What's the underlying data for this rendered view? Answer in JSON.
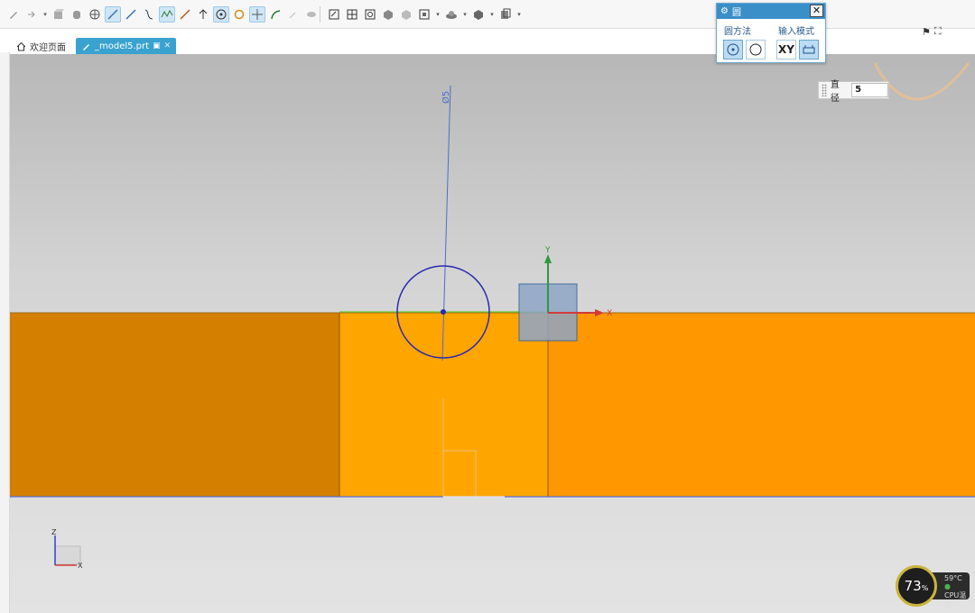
{
  "tabs": [
    {
      "label": "欢迎页面",
      "active": false
    },
    {
      "label": "_model5.prt",
      "active": true
    }
  ],
  "dialog": {
    "title": "圆",
    "method_label": "圆方法",
    "input_mode_label": "输入模式",
    "xy_label": "XY"
  },
  "dimension": {
    "label": "直径",
    "value": "5"
  },
  "annotation": {
    "diameter_text": "Ø5"
  },
  "triad": {
    "x": "X",
    "y": "Y",
    "z": "Z"
  },
  "cpu": {
    "percent": "73",
    "percent_unit": "%",
    "temperature": "59°C",
    "temp_label": "CPU温度"
  },
  "colors": {
    "face_left": "#d47f00",
    "face_middle": "#ffa500",
    "face_right": "#ff9700",
    "circle": "#2b2bb0",
    "accent": "#3b8fc9"
  },
  "toolbar_icons": [
    "sketch-icon",
    "arrow-icon",
    "box-icon",
    "sphere-icon",
    "profile-icon",
    "line-icon",
    "line-icon",
    "spline-icon",
    "polyline-icon",
    "point-icon",
    "circle-icon",
    "arc-icon",
    "cross-icon",
    "edit-icon",
    "hide-icon",
    "sketch-icon",
    "view-icon",
    "shade-icon",
    "render-icon"
  ]
}
